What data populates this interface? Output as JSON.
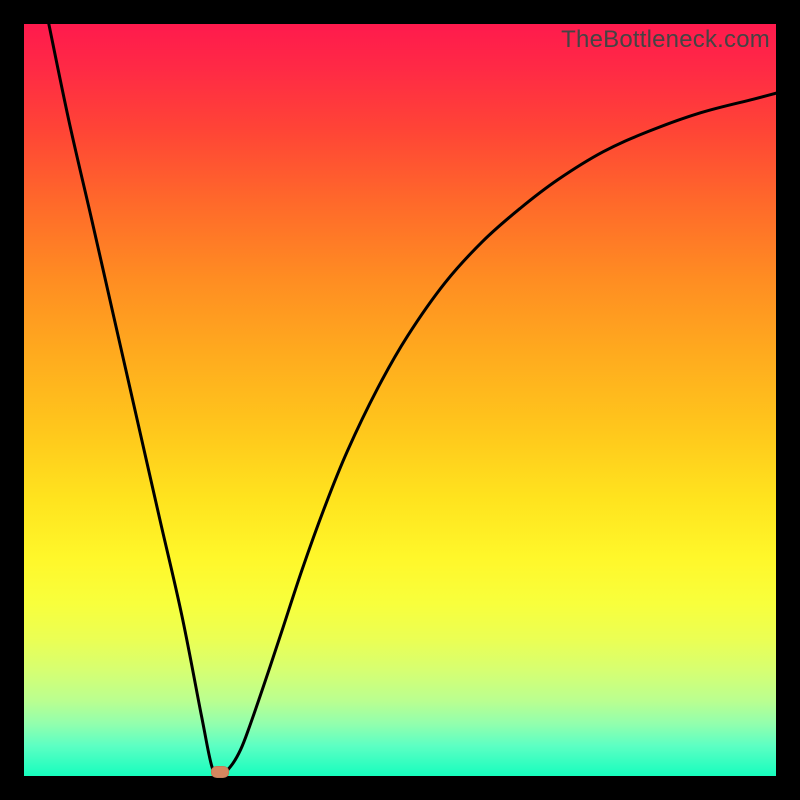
{
  "watermark": "TheBottleneck.com",
  "chart_data": {
    "type": "line",
    "title": "",
    "xlabel": "",
    "ylabel": "",
    "xlim": [
      0,
      1
    ],
    "ylim": [
      0,
      1
    ],
    "grid": false,
    "legend": false,
    "series": [
      {
        "name": "curve",
        "x": [
          0.033,
          0.06,
          0.09,
          0.12,
          0.15,
          0.18,
          0.21,
          0.236,
          0.25,
          0.26,
          0.275,
          0.288,
          0.3,
          0.32,
          0.342,
          0.37,
          0.4,
          0.43,
          0.47,
          0.51,
          0.56,
          0.61,
          0.66,
          0.71,
          0.77,
          0.83,
          0.9,
          0.97,
          1.0
        ],
        "y": [
          1.0,
          0.87,
          0.74,
          0.608,
          0.476,
          0.344,
          0.213,
          0.08,
          0.012,
          0.0,
          0.013,
          0.035,
          0.066,
          0.124,
          0.19,
          0.275,
          0.358,
          0.432,
          0.515,
          0.585,
          0.656,
          0.711,
          0.755,
          0.793,
          0.83,
          0.857,
          0.882,
          0.9,
          0.908
        ]
      }
    ],
    "marker": {
      "x_fraction": 0.261,
      "y_fraction": 0.0
    },
    "gradient": {
      "top_color": "#ff1a4d",
      "mid_color": "#ffd400",
      "bottom_color": "#16fdbe"
    }
  }
}
